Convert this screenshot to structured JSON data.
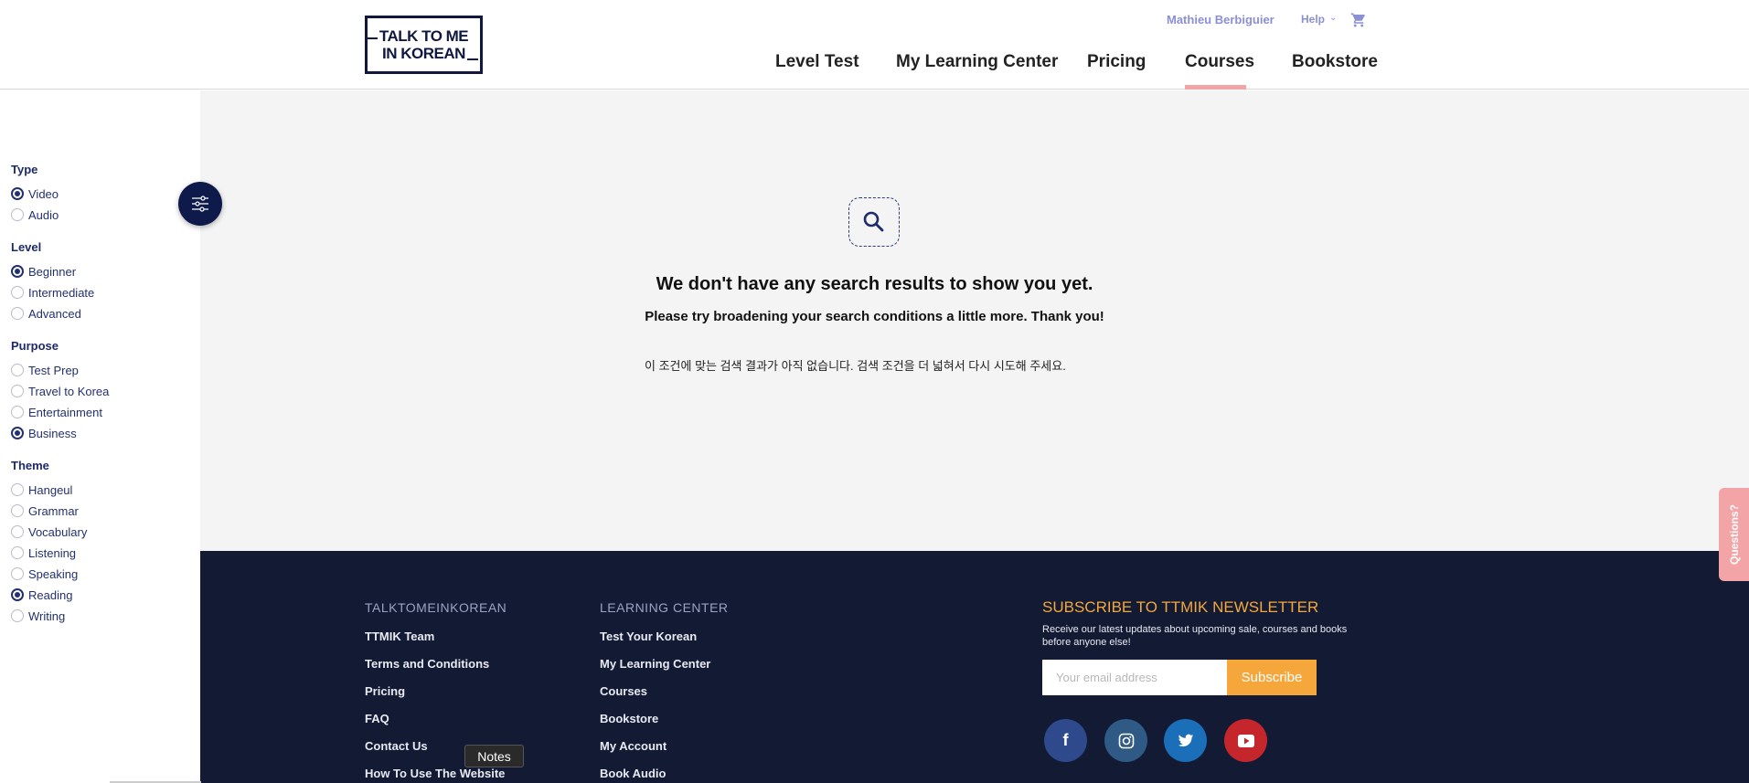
{
  "header": {
    "logo": "TALK TO ME IN KOREAN",
    "logo_line1": "TALK TO ME",
    "logo_line2": "IN KOREAN",
    "user": "Mathieu Berbiguier",
    "help": "Help",
    "cart_icon": "cart-icon",
    "nav": [
      "Level Test",
      "My Learning Center",
      "Pricing",
      "Courses",
      "Bookstore"
    ],
    "active_nav": "Courses",
    "accent_color": "#f3a4a7"
  },
  "filters": {
    "type": {
      "title": "Type",
      "options": [
        {
          "label": "Video",
          "checked": true
        },
        {
          "label": "Audio",
          "checked": false
        }
      ]
    },
    "level": {
      "title": "Level",
      "options": [
        {
          "label": "Beginner",
          "checked": true
        },
        {
          "label": "Intermediate",
          "checked": false
        },
        {
          "label": "Advanced",
          "checked": false
        }
      ]
    },
    "purpose": {
      "title": "Purpose",
      "options": [
        {
          "label": "Test Prep",
          "checked": false
        },
        {
          "label": "Travel to Korea",
          "checked": false
        },
        {
          "label": "Entertainment",
          "checked": false
        },
        {
          "label": "Business",
          "checked": true
        }
      ]
    },
    "theme": {
      "title": "Theme",
      "options": [
        {
          "label": "Hangeul",
          "checked": false
        },
        {
          "label": "Grammar",
          "checked": false
        },
        {
          "label": "Vocabulary",
          "checked": false
        },
        {
          "label": "Listening",
          "checked": false
        },
        {
          "label": "Speaking",
          "checked": false
        },
        {
          "label": "Reading",
          "checked": true
        },
        {
          "label": "Writing",
          "checked": false
        }
      ]
    },
    "toggle_icon": "sliders-icon"
  },
  "results": {
    "icon": "search-icon",
    "title": "We don't have any search results to show you yet.",
    "subtitle": "Please try broadening your search conditions a little more. Thank you!",
    "korean": "이 조건에 맞는 검색 결과가 아직 없습니다. 검색 조건을 더 넓혀서 다시 시도해 주세요."
  },
  "footer": {
    "col1_title": "TALKTOMEINKOREAN",
    "col1_links": [
      "TTMIK Team",
      "Terms and Conditions",
      "Pricing",
      "FAQ",
      "Contact Us",
      "How To Use The Website"
    ],
    "col2_title": "LEARNING CENTER",
    "col2_links": [
      "Test Your Korean",
      "My Learning Center",
      "Courses",
      "Bookstore",
      "My Account",
      "Book Audio"
    ],
    "newsletter_title": "SUBSCRIBE TO TTMIK NEWSLETTER",
    "newsletter_desc": "Receive our latest updates about upcoming sale, courses and books before anyone else!",
    "email_placeholder": "Your email address",
    "subscribe_label": "Subscribe",
    "social": [
      {
        "name": "facebook-icon",
        "glyph": "f",
        "color": "#2e4a8c"
      },
      {
        "name": "instagram-icon",
        "glyph": "◎",
        "color": "#2f5a86"
      },
      {
        "name": "twitter-icon",
        "glyph": "🐦",
        "color": "#1a6fb8"
      },
      {
        "name": "youtube-icon",
        "glyph": "▶",
        "color": "#c4262b"
      }
    ],
    "brand_color": "#f5a73b"
  },
  "tooltip": "Notes",
  "questions_tab": "Questions?"
}
